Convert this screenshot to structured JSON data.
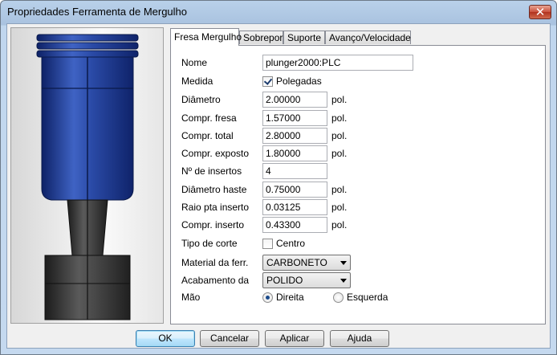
{
  "window": {
    "title": "Propriedades Ferramenta de Mergulho",
    "close_glyph": "✕"
  },
  "tabs": [
    {
      "label": "Fresa Mergulho",
      "active": true
    },
    {
      "label": "Sobrepor",
      "active": false
    },
    {
      "label": "Suporte",
      "active": false
    },
    {
      "label": "Avanço/Velocidade",
      "active": false
    }
  ],
  "form": {
    "name": {
      "label": "Nome",
      "value": "plunger2000:PLC"
    },
    "measure": {
      "label": "Medida",
      "checkbox_label": "Polegadas",
      "checked": true
    },
    "diameter": {
      "label": "Diâmetro",
      "value": "2.00000",
      "unit": "pol."
    },
    "cut_length": {
      "label": "Compr. fresa",
      "value": "1.57000",
      "unit": "pol."
    },
    "total_length": {
      "label": "Compr. total",
      "value": "2.80000",
      "unit": "pol."
    },
    "exposed_length": {
      "label": "Compr. exposto",
      "value": "1.80000",
      "unit": "pol."
    },
    "insert_count": {
      "label": "Nº de insertos",
      "value": "4"
    },
    "shank_diameter": {
      "label": "Diâmetro haste",
      "value": "0.75000",
      "unit": "pol."
    },
    "insert_tip_radius": {
      "label": "Raio pta inserto",
      "value": "0.03125",
      "unit": "pol."
    },
    "insert_length": {
      "label": "Compr. inserto",
      "value": "0.43300",
      "unit": "pol."
    },
    "cut_type": {
      "label": "Tipo de corte",
      "checkbox_label": "Centro",
      "checked": false
    },
    "tool_material": {
      "label": "Material da ferr.",
      "value": "CARBONETO"
    },
    "finish": {
      "label": "Acabamento da",
      "value": "POLIDO"
    },
    "hand": {
      "label": "Mão",
      "options": [
        "Direita",
        "Esquerda"
      ],
      "selected": "Direita"
    }
  },
  "buttons": {
    "ok": "OK",
    "cancel": "Cancelar",
    "apply": "Aplicar",
    "help": "Ajuda"
  },
  "colors": {
    "tool_blue": "#1e3c8c",
    "holder_gray": "#404040",
    "window_frame": "#c5d9ef"
  }
}
